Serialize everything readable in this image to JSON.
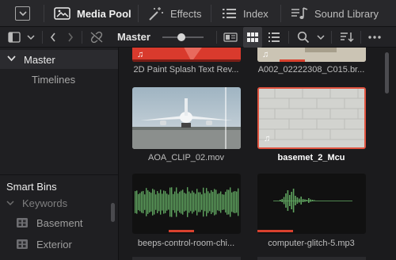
{
  "toolbar": {
    "media_pool_label": "Media Pool",
    "effects_label": "Effects",
    "index_label": "Index",
    "sound_library_label": "Sound Library"
  },
  "bin_header": {
    "title": "Master"
  },
  "sidebar": {
    "master_label": "Master",
    "timelines_label": "Timelines",
    "smart_bins_label": "Smart Bins",
    "smart_bin_items": [
      {
        "label": "Keywords"
      },
      {
        "label": "Basement"
      },
      {
        "label": "Exterior"
      }
    ]
  },
  "clips": [
    {
      "name": "2D Paint Splash Text Rev...",
      "kind": "audio-video"
    },
    {
      "name": "A002_02222308_C015.br...",
      "kind": "audio-video"
    },
    {
      "name": "AOA_CLIP_02.mov",
      "kind": "video"
    },
    {
      "name": "basemet_2_Mcu",
      "kind": "audio-video",
      "selected": true
    },
    {
      "name": "beeps-control-room-chi...",
      "kind": "audio"
    },
    {
      "name": "computer-glitch-5.mp3",
      "kind": "audio"
    }
  ],
  "colors": {
    "selection": "#e0533f",
    "audio_wave": "#5fa35f",
    "progress": "#d9412e",
    "accent_active": "#f2f2f2"
  }
}
